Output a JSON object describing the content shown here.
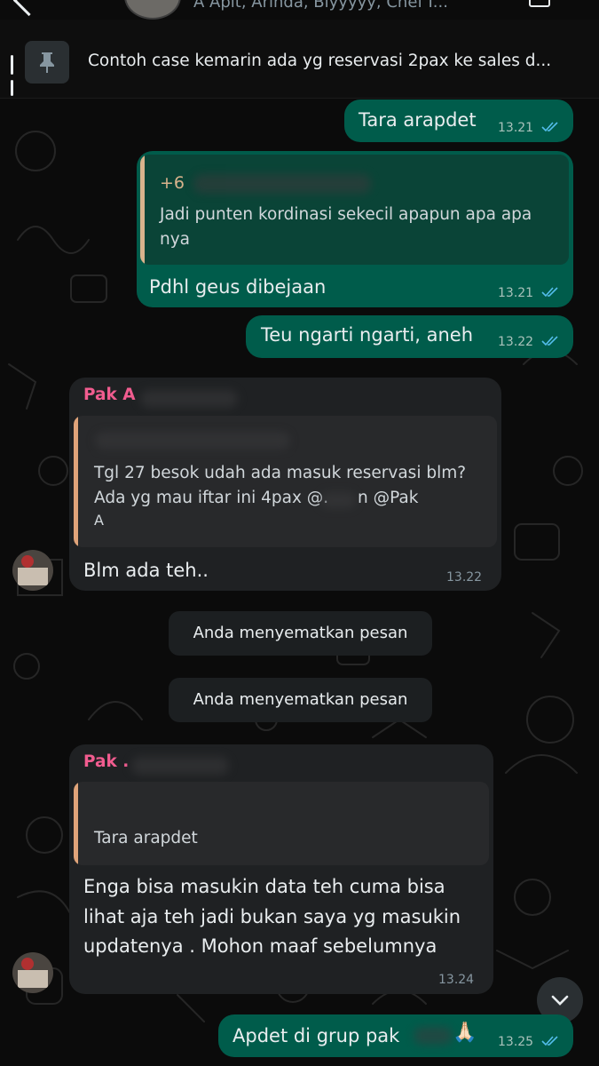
{
  "header": {
    "members": "A Apit, Arinda, Biyyyyy, Chef I..."
  },
  "pinned": {
    "text": "Contoh case kemarin ada yg reservasi 2pax ke sales d..."
  },
  "messages": {
    "m1": {
      "text": "Tara arapdet",
      "time": "13.21"
    },
    "m2": {
      "quote_sender": "+6",
      "quote_line1": "Jadi punten kordinasi sekecil apapun apa apa",
      "quote_line2": "nya",
      "text": "Pdhl geus dibejaan",
      "time": "13.21"
    },
    "m3": {
      "text": "Teu ngarti ngarti, aneh",
      "time": "13.22"
    },
    "m4": {
      "sender": "Pak A",
      "quote_line1": "Tgl 27 besok udah ada masuk reservasi blm?",
      "quote_line2a": "Ada yg mau iftar ini 4pax @.",
      "quote_line2b": "n @Pak",
      "quote_line3": "A",
      "text": "Blm ada teh..",
      "time": "13.22"
    },
    "sys1": "Anda menyematkan pesan",
    "sys2": "Anda menyematkan pesan",
    "m5": {
      "sender": "Pak .",
      "quote_line1": "Tara arapdet",
      "line1": "Enga bisa masukin data teh cuma bisa",
      "line2": "lihat aja teh jadi bukan saya yg masukin",
      "line3": "updatenya . Mohon maaf sebelumnya",
      "time": "13.24"
    },
    "m6": {
      "text": "Apdet di grup pak",
      "emoji": "🙏🏻",
      "time": "13.25"
    }
  },
  "colors": {
    "outgoing": "#005c4b",
    "incoming": "#1f2123",
    "sender_name": "#f15c8f",
    "quote_bar_in": "#e0a47a",
    "quote_bar_out": "#d9b38c",
    "read_ticks": "#53bdeb"
  }
}
